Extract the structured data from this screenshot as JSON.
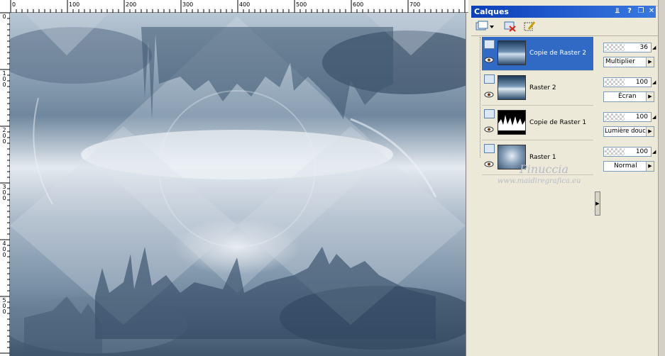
{
  "ruler": {
    "top_labels": [
      "0",
      "100",
      "200",
      "300",
      "400",
      "500",
      "600",
      "700"
    ],
    "left_labels": [
      "0",
      "1\n0\n0",
      "2\n0\n0",
      "3\n0\n0",
      "4\n0\n0",
      "5\n0\n0"
    ]
  },
  "palette": {
    "title": "Calques",
    "title_buttons": [
      "pin-icon",
      "help-icon",
      "restore-icon",
      "close-icon"
    ],
    "tools": [
      "new-layer-icon",
      "delete-layer-icon",
      "edit-selection-icon"
    ]
  },
  "layers": [
    {
      "name": "Copie de Raster 2",
      "selected": true,
      "opacity": "36",
      "blend": "Multiplier"
    },
    {
      "name": "Raster 2",
      "selected": false,
      "opacity": "100",
      "blend": "Écran"
    },
    {
      "name": "Copie de Raster 1",
      "selected": false,
      "opacity": "100",
      "blend": "Lumière douce"
    },
    {
      "name": "Raster 1",
      "selected": false,
      "opacity": "100",
      "blend": "Normal"
    }
  ],
  "watermark": {
    "name": "Pinuccia",
    "site": "www.maidiregrafica.eu"
  },
  "colors": {
    "title_bar": "#0a3fb8",
    "selection": "#316ac5",
    "panel_bg": "#ece9d8"
  }
}
